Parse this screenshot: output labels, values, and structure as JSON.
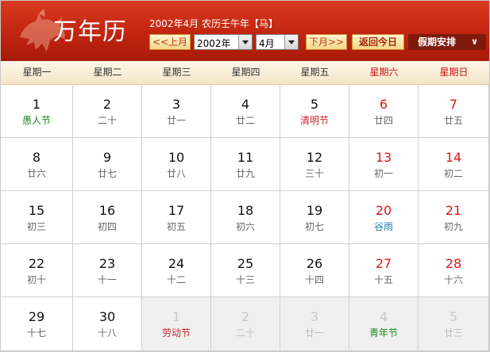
{
  "header": {
    "title": "万年历",
    "lunar_info": "2002年4月 农历壬午年【马】",
    "prev_label": "<<上月",
    "year_value": "2002年",
    "month_value": "4月",
    "next_label": "下月>>",
    "today_label": "返回今日",
    "holiday_label": "假期安排",
    "holiday_icon": "chevron-down-icon"
  },
  "weekdays": [
    "星期一",
    "星期二",
    "星期三",
    "星期四",
    "星期五",
    "星期六",
    "星期日"
  ],
  "colors": {
    "header_red": "#c1250f",
    "weekend_red": "#e01515",
    "festival_green": "#1b8a1b",
    "holiday_red": "#c8242a",
    "solar_term_blue": "#1c78b0"
  },
  "days": [
    {
      "day": "1",
      "sub": "愚人节",
      "type": "festival"
    },
    {
      "day": "2",
      "sub": "二十"
    },
    {
      "day": "3",
      "sub": "廿一"
    },
    {
      "day": "4",
      "sub": "廿二"
    },
    {
      "day": "5",
      "sub": "清明节",
      "type": "red"
    },
    {
      "day": "6",
      "sub": "廿四",
      "weekend": true
    },
    {
      "day": "7",
      "sub": "廿五",
      "weekend": true
    },
    {
      "day": "8",
      "sub": "廿六"
    },
    {
      "day": "9",
      "sub": "廿七"
    },
    {
      "day": "10",
      "sub": "廿八"
    },
    {
      "day": "11",
      "sub": "廿九"
    },
    {
      "day": "12",
      "sub": "三十"
    },
    {
      "day": "13",
      "sub": "初一",
      "weekend": true
    },
    {
      "day": "14",
      "sub": "初二",
      "weekend": true
    },
    {
      "day": "15",
      "sub": "初三"
    },
    {
      "day": "16",
      "sub": "初四"
    },
    {
      "day": "17",
      "sub": "初五"
    },
    {
      "day": "18",
      "sub": "初六"
    },
    {
      "day": "19",
      "sub": "初七"
    },
    {
      "day": "20",
      "sub": "谷雨",
      "type": "term",
      "weekend": true
    },
    {
      "day": "21",
      "sub": "初九",
      "weekend": true
    },
    {
      "day": "22",
      "sub": "初十"
    },
    {
      "day": "23",
      "sub": "十一"
    },
    {
      "day": "24",
      "sub": "十二"
    },
    {
      "day": "25",
      "sub": "十三"
    },
    {
      "day": "26",
      "sub": "十四"
    },
    {
      "day": "27",
      "sub": "十五",
      "weekend": true
    },
    {
      "day": "28",
      "sub": "十六",
      "weekend": true
    },
    {
      "day": "29",
      "sub": "十七"
    },
    {
      "day": "30",
      "sub": "十八"
    },
    {
      "day": "1",
      "sub": "劳动节",
      "type": "red",
      "out": true
    },
    {
      "day": "2",
      "sub": "二十",
      "out": true
    },
    {
      "day": "3",
      "sub": "廿一",
      "out": true
    },
    {
      "day": "4",
      "sub": "青年节",
      "type": "festival",
      "out": true
    },
    {
      "day": "5",
      "sub": "廿三",
      "out": true
    }
  ]
}
